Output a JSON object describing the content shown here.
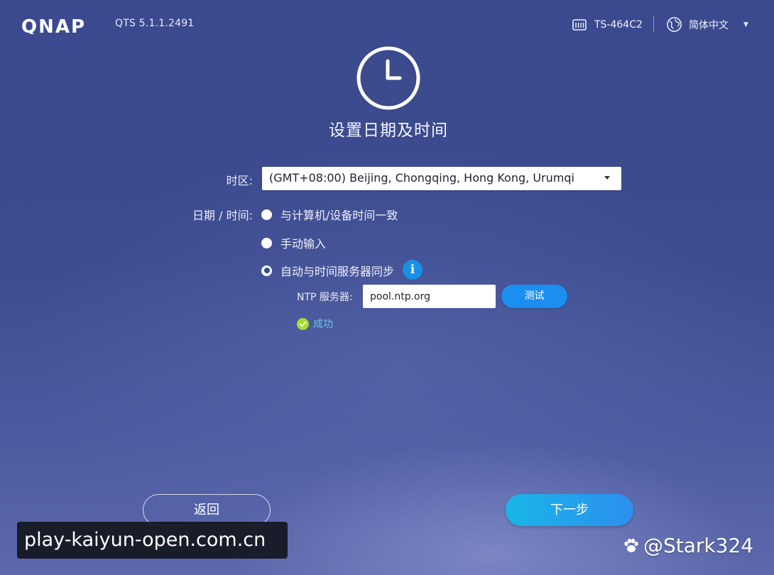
{
  "header": {
    "logo_text": "QNAP",
    "version": "QTS 5.1.1.2491",
    "model": "TS-464C2",
    "language": "简体中文",
    "icons": {
      "model": "nas-device-icon",
      "language": "globe-icon",
      "caret": "caret-down-icon"
    }
  },
  "page": {
    "title": "设置日期及时间",
    "title_icon": "clock-icon"
  },
  "form": {
    "timezone_label": "时区:",
    "timezone_value": "(GMT+08:00) Beijing, Chongqing, Hong Kong, Urumqi",
    "datetime_label": "日期 / 时间:",
    "options": [
      {
        "label": "与计算机/设备时间一致",
        "selected": false
      },
      {
        "label": "手动输入",
        "selected": false
      },
      {
        "label": "自动与时间服务器同步",
        "selected": true
      }
    ],
    "ntp_label": "NTP 服务器:",
    "ntp_value": "pool.ntp.org",
    "test_label": "测试",
    "status_text": "成功",
    "info_glyph": "i"
  },
  "nav": {
    "back_label": "返回",
    "next_label": "下一步"
  },
  "watermarks": {
    "url": "play-kaiyun-open.com.cn",
    "author": "@Stark324"
  },
  "colors": {
    "background": "#3d4b8f",
    "accent_blue": "#1b8ff0",
    "success_green": "#a6dc2f",
    "success_text": "#5fd0dd"
  }
}
